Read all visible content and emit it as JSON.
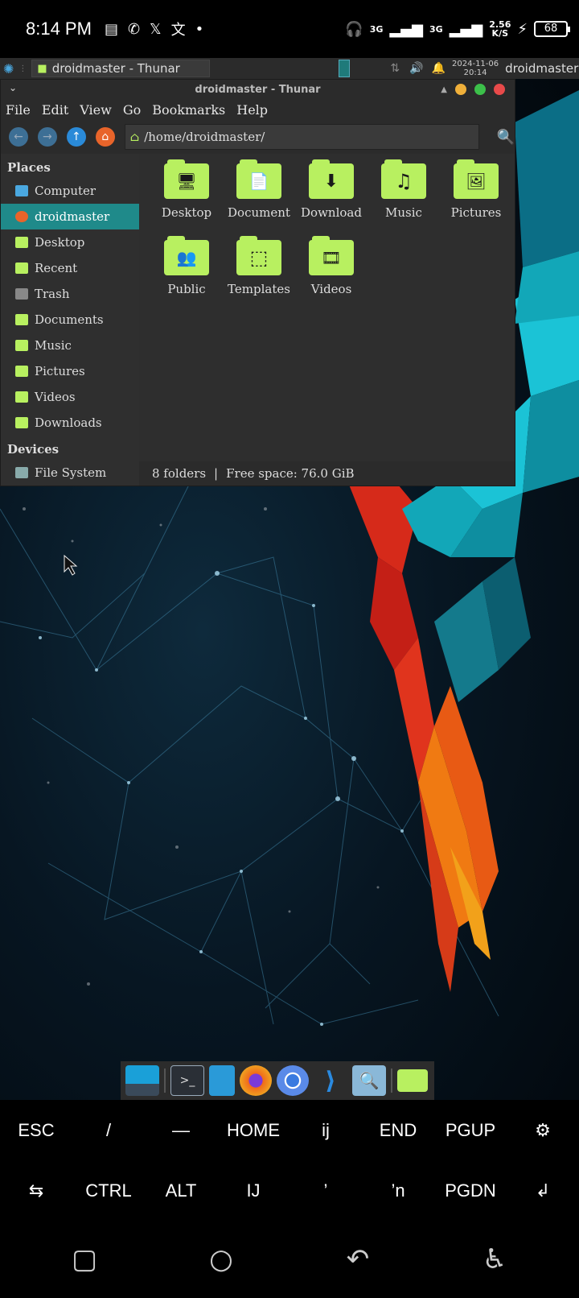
{
  "status_bar": {
    "time": "8:14 PM",
    "net_down": "3G",
    "net_up": "3G",
    "speed_value": "2.56",
    "speed_unit": "K/S",
    "battery": "68"
  },
  "panel": {
    "task_title": "droidmaster - Thunar",
    "clock_date": "2024-11-06",
    "clock_time": "20:14",
    "user": "droidmaster"
  },
  "window": {
    "title": "droidmaster - Thunar",
    "menu": [
      "File",
      "Edit",
      "View",
      "Go",
      "Bookmarks",
      "Help"
    ],
    "path": "/home/droidmaster/",
    "places_header": "Places",
    "places": [
      {
        "label": "Computer",
        "icon": "computer-icon"
      },
      {
        "label": "droidmaster",
        "icon": "home-icon",
        "selected": true
      },
      {
        "label": "Desktop",
        "icon": "desktop-folder-icon"
      },
      {
        "label": "Recent",
        "icon": "recent-icon"
      },
      {
        "label": "Trash",
        "icon": "trash-icon"
      },
      {
        "label": "Documents",
        "icon": "documents-icon"
      },
      {
        "label": "Music",
        "icon": "music-icon"
      },
      {
        "label": "Pictures",
        "icon": "pictures-icon"
      },
      {
        "label": "Videos",
        "icon": "videos-icon"
      },
      {
        "label": "Downloads",
        "icon": "downloads-icon"
      }
    ],
    "devices_header": "Devices",
    "devices": [
      {
        "label": "File System",
        "icon": "drive-icon"
      }
    ],
    "folders": [
      {
        "label": "Desktop",
        "glyph": "🖥"
      },
      {
        "label": "Document",
        "glyph": "📄"
      },
      {
        "label": "Download",
        "glyph": "⬇"
      },
      {
        "label": "Music",
        "glyph": "♫"
      },
      {
        "label": "Pictures",
        "glyph": "🖼"
      },
      {
        "label": "Public",
        "glyph": "👥"
      },
      {
        "label": "Templates",
        "glyph": "⬚"
      },
      {
        "label": "Videos",
        "glyph": "🎞"
      }
    ],
    "status_count": "8 folders",
    "status_sep": "|",
    "status_free": "Free space: 76.0 GiB"
  },
  "extra_keys": {
    "row1": [
      "ESC",
      "/",
      "—",
      "HOME",
      "ij",
      "END",
      "PGUP",
      "⚙"
    ],
    "row2": [
      "⇆",
      "CTRL",
      "ALT",
      "IJ",
      "’",
      "’n",
      "PGDN",
      "↲"
    ]
  },
  "colors": {
    "folder_green": "#b8f060",
    "selection_teal": "#1f8a8a",
    "close_red": "#e84a4a",
    "min_yellow": "#f0b03a",
    "max_green": "#3cc04a"
  }
}
